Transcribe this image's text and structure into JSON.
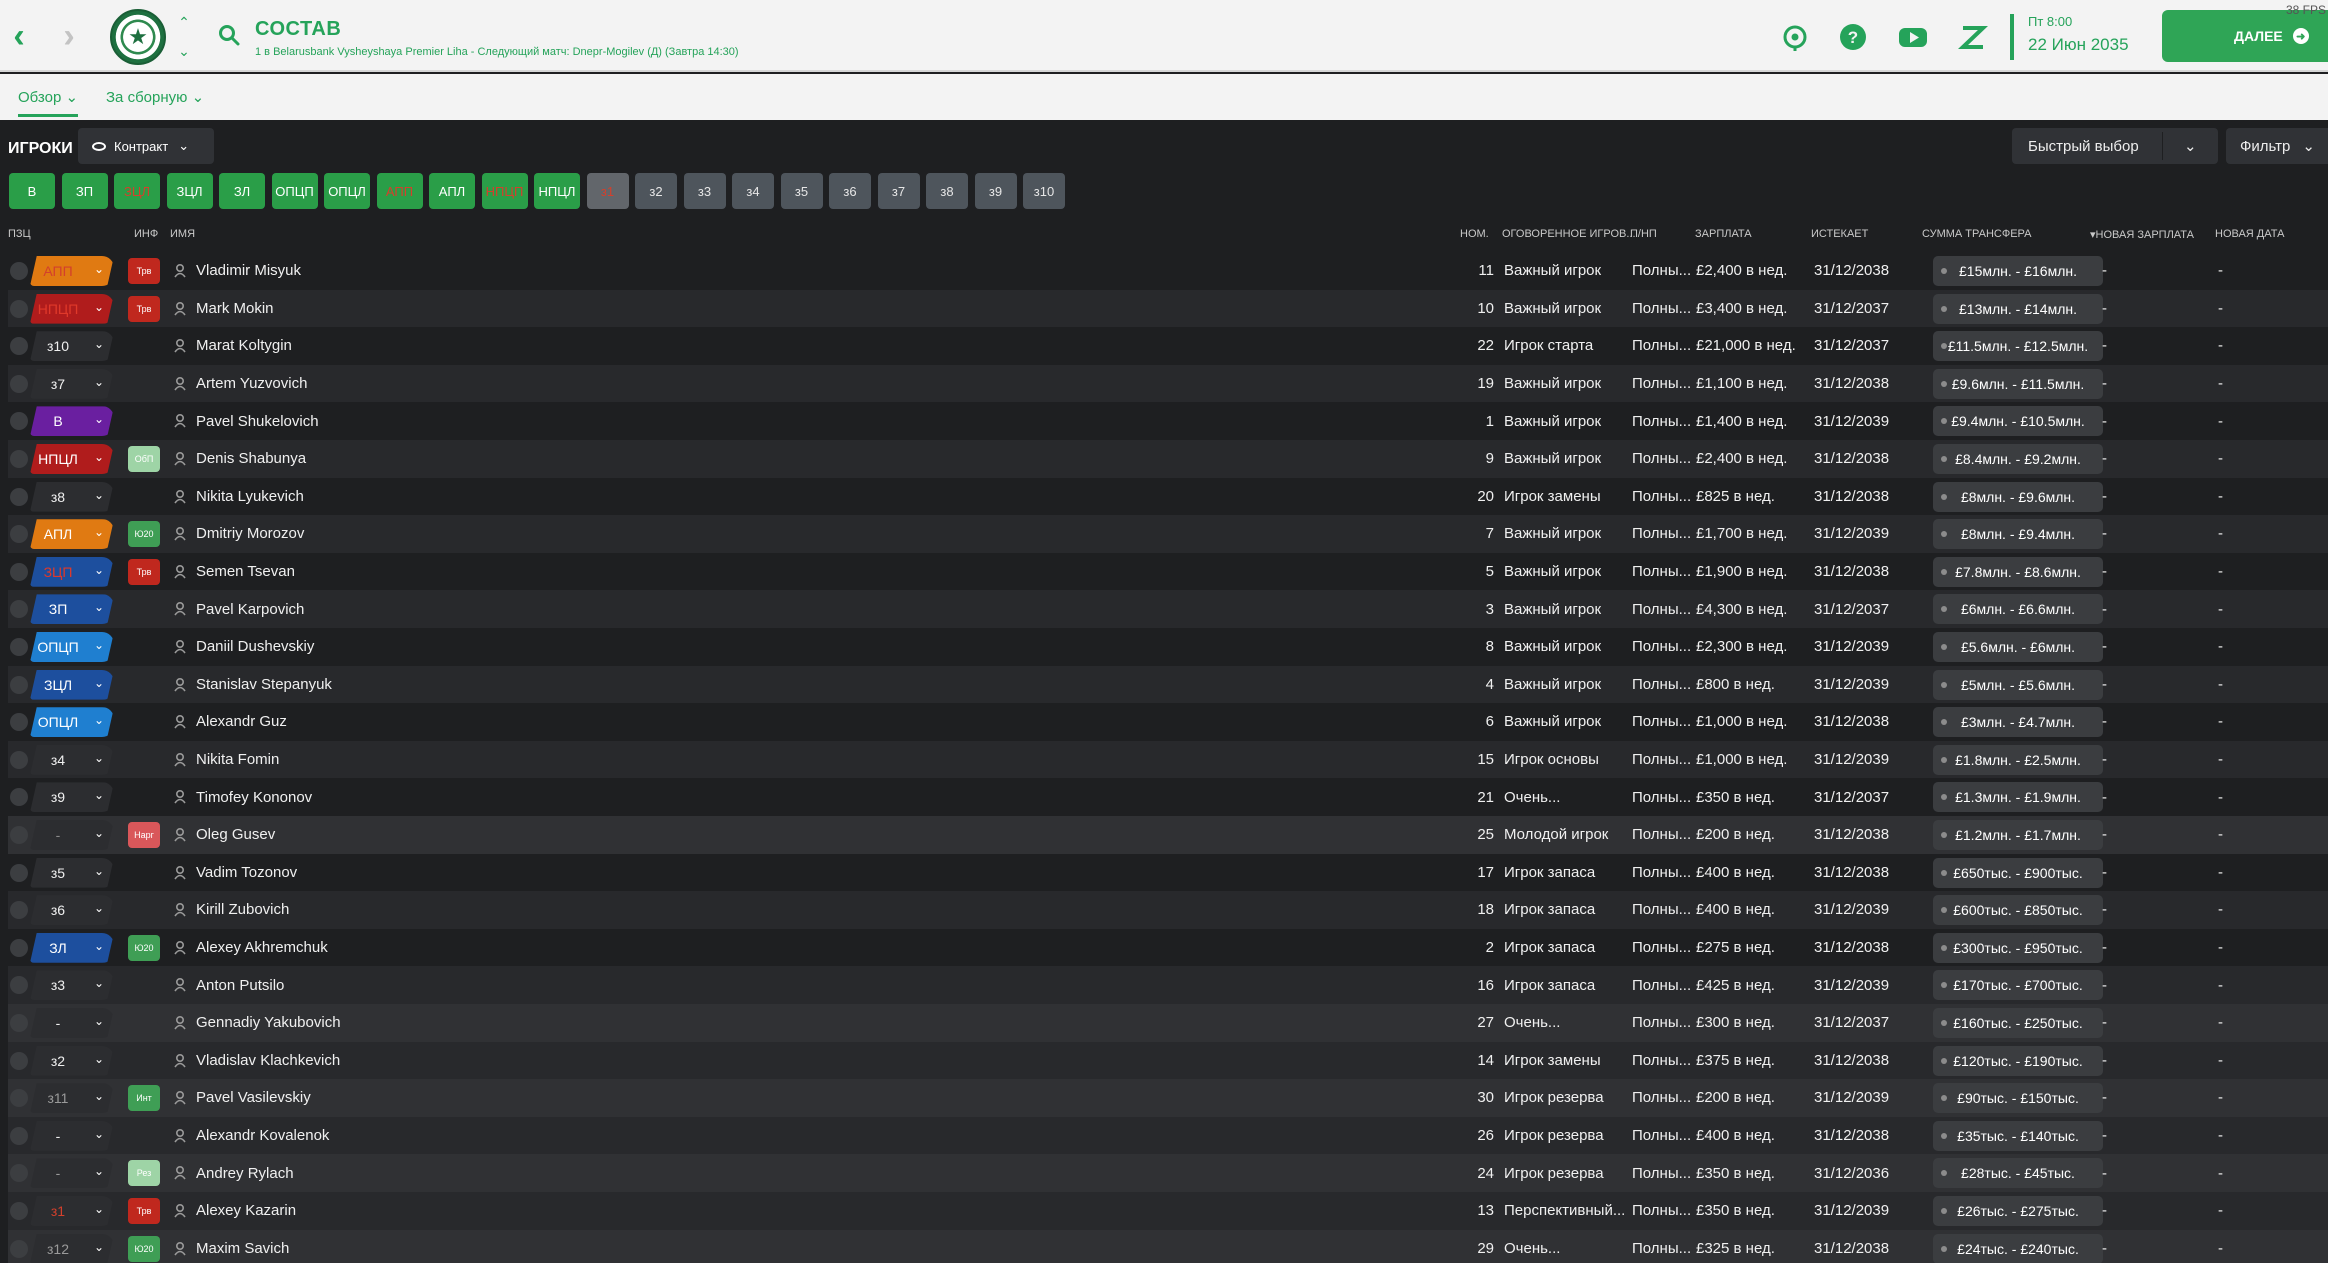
{
  "topbar": {
    "title": "СОСТАВ",
    "subtitle": "1 в Belarusbank Vysheyshaya Premier Liha - Следующий матч: Dnepr-Mogilev (Д) (Завтра 14:30)",
    "date_time": "Пт 8:00",
    "date_day": "22 Июн 2035",
    "continue_label": "ДАЛЕЕ",
    "fps": "38 FPS",
    "icons": [
      "back-icon",
      "forward-icon",
      "club-crest",
      "search-icon",
      "football-icon",
      "help-icon",
      "video-icon",
      "z-icon",
      "arrow-right-icon"
    ]
  },
  "subtabs": [
    {
      "label": "Обзор",
      "active": true
    },
    {
      "label": "За сборную",
      "active": false
    }
  ],
  "toolbar": {
    "section_title": "ИГРОКИ",
    "view_label": "Контракт",
    "quick_pick_label": "Быстрый выбор",
    "filter_label": "Фильтр"
  },
  "position_filters": [
    {
      "label": "В",
      "style": "green"
    },
    {
      "label": "ЗП",
      "style": "green"
    },
    {
      "label": "ЗЦЛ",
      "style": "green-dim"
    },
    {
      "label": "ЗЦЛ",
      "style": "green"
    },
    {
      "label": "ЗЛ",
      "style": "green"
    },
    {
      "label": "ОПЦП",
      "style": "green"
    },
    {
      "label": "ОПЦЛ",
      "style": "green"
    },
    {
      "label": "АПП",
      "style": "green-dim"
    },
    {
      "label": "АПЛ",
      "style": "green"
    },
    {
      "label": "НПЦП",
      "style": "green-dim"
    },
    {
      "label": "НПЦЛ",
      "style": "green"
    },
    {
      "label": "з1",
      "style": "grey-dim"
    },
    {
      "label": "з2",
      "style": "grey"
    },
    {
      "label": "з3",
      "style": "grey"
    },
    {
      "label": "з4",
      "style": "grey"
    },
    {
      "label": "з5",
      "style": "grey"
    },
    {
      "label": "з6",
      "style": "grey"
    },
    {
      "label": "з7",
      "style": "grey"
    },
    {
      "label": "з8",
      "style": "grey"
    },
    {
      "label": "з9",
      "style": "grey"
    },
    {
      "label": "з10",
      "style": "grey"
    }
  ],
  "columns": {
    "pos": "ПЗЦ",
    "info": "ИНФ",
    "name": "ИМЯ",
    "num": "НОМ.",
    "status": "ОГОВОРЕННОЕ ИГРОВ...",
    "type": "П/НП",
    "wage": "ЗАРПЛАТА",
    "expires": "ИСТЕКАЕТ",
    "transfer": "СУММА ТРАНСФЕРА",
    "new_wage": "НОВАЯ ЗАРПЛАТА",
    "new_date": "НОВАЯ ДАТА"
  },
  "rows": [
    {
      "pos": "АПП",
      "pos_color": "#e07a12",
      "pos_text": "#d3402c",
      "info": "Трв",
      "info_color": "#c0281e",
      "name": "Vladimir Misyuk",
      "num": "11",
      "status": "Важный игрок",
      "type": "Полны...",
      "wage": "£2,400 в нед.",
      "expires": "31/12/2038",
      "transfer": "£15млн. - £16млн.",
      "new_wage": "-",
      "new_date": "-"
    },
    {
      "pos": "НПЦП",
      "pos_color": "#b01c1c",
      "pos_text": "#e0392a",
      "info": "Трв",
      "info_color": "#c0281e",
      "name": "Mark Mokin",
      "num": "10",
      "status": "Важный игрок",
      "type": "Полны...",
      "wage": "£3,400 в нед.",
      "expires": "31/12/2037",
      "transfer": "£13млн. - £14млн.",
      "new_wage": "-",
      "new_date": "-"
    },
    {
      "pos": "з10",
      "pos_color": "",
      "pos_text": "#f0f0f0",
      "info": "",
      "info_color": "",
      "name": "Marat Koltygin",
      "num": "22",
      "status": "Игрок старта",
      "type": "Полны...",
      "wage": "£21,000 в нед.",
      "expires": "31/12/2037",
      "transfer": "£11.5млн. - £12.5млн.",
      "new_wage": "-",
      "new_date": "-"
    },
    {
      "pos": "з7",
      "pos_color": "",
      "pos_text": "#f0f0f0",
      "info": "",
      "info_color": "",
      "name": "Artem Yuzvovich",
      "num": "19",
      "status": "Важный игрок",
      "type": "Полны...",
      "wage": "£1,100 в нед.",
      "expires": "31/12/2038",
      "transfer": "£9.6млн. - £11.5млн.",
      "new_wage": "-",
      "new_date": "-"
    },
    {
      "pos": "В",
      "pos_color": "#6a1fa0",
      "pos_text": "#ffffff",
      "info": "",
      "info_color": "",
      "name": "Pavel Shukelovich",
      "num": "1",
      "status": "Важный игрок",
      "type": "Полны...",
      "wage": "£1,400 в нед.",
      "expires": "31/12/2039",
      "transfer": "£9.4млн. - £10.5млн.",
      "new_wage": "-",
      "new_date": "-"
    },
    {
      "pos": "НПЦЛ",
      "pos_color": "#b01c1c",
      "pos_text": "#ffffff",
      "info": "ОбП",
      "info_color": "#9ed4a6",
      "name": "Denis Shabunya",
      "num": "9",
      "status": "Важный игрок",
      "type": "Полны...",
      "wage": "£2,400 в нед.",
      "expires": "31/12/2038",
      "transfer": "£8.4млн. - £9.2млн.",
      "new_wage": "-",
      "new_date": "-"
    },
    {
      "pos": "з8",
      "pos_color": "",
      "pos_text": "#f0f0f0",
      "info": "",
      "info_color": "",
      "name": "Nikita Lyukevich",
      "num": "20",
      "status": "Игрок замены",
      "type": "Полны...",
      "wage": "£825 в нед.",
      "expires": "31/12/2038",
      "transfer": "£8млн. - £9.6млн.",
      "new_wage": "-",
      "new_date": "-"
    },
    {
      "pos": "АПЛ",
      "pos_color": "#e07a12",
      "pos_text": "#ffffff",
      "info": "Ю20",
      "info_color": "#3f9e55",
      "name": "Dmitriy Morozov",
      "num": "7",
      "status": "Важный игрок",
      "type": "Полны...",
      "wage": "£1,700 в нед.",
      "expires": "31/12/2039",
      "transfer": "£8млн. - £9.4млн.",
      "new_wage": "-",
      "new_date": "-"
    },
    {
      "pos": "ЗЦП",
      "pos_color": "#1d4f9e",
      "pos_text": "#e0392a",
      "info": "Трв",
      "info_color": "#c0281e",
      "name": "Semen Tsevan",
      "num": "5",
      "status": "Важный игрок",
      "type": "Полны...",
      "wage": "£1,900 в нед.",
      "expires": "31/12/2038",
      "transfer": "£7.8млн. - £8.6млн.",
      "new_wage": "-",
      "new_date": "-"
    },
    {
      "pos": "ЗП",
      "pos_color": "#1d4f9e",
      "pos_text": "#ffffff",
      "info": "",
      "info_color": "",
      "name": "Pavel Karpovich",
      "num": "3",
      "status": "Важный игрок",
      "type": "Полны...",
      "wage": "£4,300 в нед.",
      "expires": "31/12/2037",
      "transfer": "£6млн. - £6.6млн.",
      "new_wage": "-",
      "new_date": "-"
    },
    {
      "pos": "ОПЦП",
      "pos_color": "#1f7fd0",
      "pos_text": "#ffffff",
      "info": "",
      "info_color": "",
      "name": "Daniil Dushevskiy",
      "num": "8",
      "status": "Важный игрок",
      "type": "Полны...",
      "wage": "£2,300 в нед.",
      "expires": "31/12/2039",
      "transfer": "£5.6млн. - £6млн.",
      "new_wage": "-",
      "new_date": "-"
    },
    {
      "pos": "ЗЦЛ",
      "pos_color": "#1d4f9e",
      "pos_text": "#ffffff",
      "info": "",
      "info_color": "",
      "name": "Stanislav Stepanyuk",
      "num": "4",
      "status": "Важный игрок",
      "type": "Полны...",
      "wage": "£800 в нед.",
      "expires": "31/12/2039",
      "transfer": "£5млн. - £5.6млн.",
      "new_wage": "-",
      "new_date": "-"
    },
    {
      "pos": "ОПЦЛ",
      "pos_color": "#1f7fd0",
      "pos_text": "#ffffff",
      "info": "",
      "info_color": "",
      "name": "Alexandr Guz",
      "num": "6",
      "status": "Важный игрок",
      "type": "Полны...",
      "wage": "£1,000 в нед.",
      "expires": "31/12/2038",
      "transfer": "£3млн. - £4.7млн.",
      "new_wage": "-",
      "new_date": "-"
    },
    {
      "pos": "з4",
      "pos_color": "",
      "pos_text": "#f0f0f0",
      "info": "",
      "info_color": "",
      "name": "Nikita Fomin",
      "num": "15",
      "status": "Игрок основы",
      "type": "Полны...",
      "wage": "£1,000 в нед.",
      "expires": "31/12/2039",
      "transfer": "£1.8млн. - £2.5млн.",
      "new_wage": "-",
      "new_date": "-"
    },
    {
      "pos": "з9",
      "pos_color": "",
      "pos_text": "#f0f0f0",
      "info": "",
      "info_color": "",
      "name": "Timofey Kononov",
      "num": "21",
      "status": "Очень...",
      "type": "Полны...",
      "wage": "£350 в нед.",
      "expires": "31/12/2037",
      "transfer": "£1.3млн. - £1.9млн.",
      "new_wage": "-",
      "new_date": "-"
    },
    {
      "pos": "-",
      "pos_color": "",
      "pos_text": "#8a8a8a",
      "info": "Нарг",
      "info_color": "#d9575a",
      "name": "Oleg Gusev",
      "num": "25",
      "status": "Молодой игрок",
      "type": "Полны...",
      "wage": "£200 в нед.",
      "expires": "31/12/2038",
      "transfer": "£1.2млн. - £1.7млн.",
      "new_wage": "-",
      "new_date": "-"
    },
    {
      "pos": "з5",
      "pos_color": "",
      "pos_text": "#f0f0f0",
      "info": "",
      "info_color": "",
      "name": "Vadim Tozonov",
      "num": "17",
      "status": "Игрок запаса",
      "type": "Полны...",
      "wage": "£400 в нед.",
      "expires": "31/12/2038",
      "transfer": "£650тыс. - £900тыс.",
      "new_wage": "-",
      "new_date": "-"
    },
    {
      "pos": "з6",
      "pos_color": "",
      "pos_text": "#f0f0f0",
      "info": "",
      "info_color": "",
      "name": "Kirill Zubovich",
      "num": "18",
      "status": "Игрок запаса",
      "type": "Полны...",
      "wage": "£400 в нед.",
      "expires": "31/12/2039",
      "transfer": "£600тыс. - £850тыс.",
      "new_wage": "-",
      "new_date": "-"
    },
    {
      "pos": "ЗЛ",
      "pos_color": "#1d4f9e",
      "pos_text": "#ffffff",
      "info": "Ю20",
      "info_color": "#3f9e55",
      "name": "Alexey Akhremchuk",
      "num": "2",
      "status": "Игрок запаса",
      "type": "Полны...",
      "wage": "£275 в нед.",
      "expires": "31/12/2038",
      "transfer": "£300тыс. - £950тыс.",
      "new_wage": "-",
      "new_date": "-"
    },
    {
      "pos": "з3",
      "pos_color": "",
      "pos_text": "#f0f0f0",
      "info": "",
      "info_color": "",
      "name": "Anton Putsilo",
      "num": "16",
      "status": "Игрок запаса",
      "type": "Полны...",
      "wage": "£425 в нед.",
      "expires": "31/12/2039",
      "transfer": "£170тыс. - £700тыс.",
      "new_wage": "-",
      "new_date": "-"
    },
    {
      "pos": "-",
      "pos_color": "",
      "pos_text": "#f0f0f0",
      "info": "",
      "info_color": "",
      "name": "Gennadiy Yakubovich",
      "num": "27",
      "status": "Очень...",
      "type": "Полны...",
      "wage": "£300 в нед.",
      "expires": "31/12/2037",
      "transfer": "£160тыс. - £250тыс.",
      "new_wage": "-",
      "new_date": "-"
    },
    {
      "pos": "з2",
      "pos_color": "",
      "pos_text": "#f0f0f0",
      "info": "",
      "info_color": "",
      "name": "Vladislav Klachkevich",
      "num": "14",
      "status": "Игрок замены",
      "type": "Полны...",
      "wage": "£375 в нед.",
      "expires": "31/12/2038",
      "transfer": "£120тыс. - £190тыс.",
      "new_wage": "-",
      "new_date": "-"
    },
    {
      "pos": "з11",
      "pos_color": "",
      "pos_text": "#9a9a9a",
      "info": "Инт",
      "info_color": "#3f9e55",
      "name": "Pavel Vasilevskiy",
      "num": "30",
      "status": "Игрок резерва",
      "type": "Полны...",
      "wage": "£200 в нед.",
      "expires": "31/12/2039",
      "transfer": "£90тыс. - £150тыс.",
      "new_wage": "-",
      "new_date": "-"
    },
    {
      "pos": "-",
      "pos_color": "",
      "pos_text": "#f0f0f0",
      "info": "",
      "info_color": "",
      "name": "Alexandr Kovalenok",
      "num": "26",
      "status": "Игрок резерва",
      "type": "Полны...",
      "wage": "£400 в нед.",
      "expires": "31/12/2038",
      "transfer": "£35тыс. - £140тыс.",
      "new_wage": "-",
      "new_date": "-"
    },
    {
      "pos": "-",
      "pos_color": "",
      "pos_text": "#9a9a9a",
      "info": "Рез",
      "info_color": "#9ed4a6",
      "name": "Andrey Rylach",
      "num": "24",
      "status": "Игрок резерва",
      "type": "Полны...",
      "wage": "£350 в нед.",
      "expires": "31/12/2036",
      "transfer": "£28тыс. - £45тыс.",
      "new_wage": "-",
      "new_date": "-"
    },
    {
      "pos": "з1",
      "pos_color": "",
      "pos_text": "#d3402c",
      "info": "Трв",
      "info_color": "#c0281e",
      "name": "Alexey Kazarin",
      "num": "13",
      "status": "Перспективный...",
      "type": "Полны...",
      "wage": "£350 в нед.",
      "expires": "31/12/2039",
      "transfer": "£26тыс. - £275тыс.",
      "new_wage": "-",
      "new_date": "-"
    },
    {
      "pos": "з12",
      "pos_color": "",
      "pos_text": "#9a9a9a",
      "info": "Ю20",
      "info_color": "#3f9e55",
      "name": "Maxim Savich",
      "num": "29",
      "status": "Очень...",
      "type": "Полны...",
      "wage": "£325 в нед.",
      "expires": "31/12/2038",
      "transfer": "£24тыс. - £240тыс.",
      "new_wage": "-",
      "new_date": "-"
    }
  ]
}
